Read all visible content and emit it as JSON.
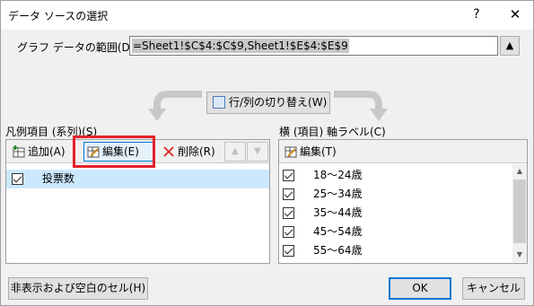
{
  "window": {
    "title": "データ ソースの選択",
    "help": "?",
    "close": "✕"
  },
  "range": {
    "label": "グラフ データの範囲(D):",
    "value": "=Sheet1!$C$4:$C$9,Sheet1!$E$4:$E$9"
  },
  "switch_button": {
    "label": "行/列の切り替え(W)"
  },
  "legend": {
    "header": "凡例項目 (系列)(S)",
    "add_label": "追加(A)",
    "edit_label": "編集(E)",
    "delete_label": "削除(R)",
    "items": [
      {
        "label": "投票数",
        "checked": true
      }
    ]
  },
  "axis": {
    "header": "横 (項目) 軸ラベル(C)",
    "edit_label": "編集(T)",
    "items": [
      {
        "label": "18～24歳",
        "checked": true
      },
      {
        "label": "25～34歳",
        "checked": true
      },
      {
        "label": "35～44歳",
        "checked": true
      },
      {
        "label": "45～54歳",
        "checked": true
      },
      {
        "label": "55～64歳",
        "checked": true
      }
    ]
  },
  "footer": {
    "hidden_cells_label": "非表示および空白のセル(H)",
    "ok_label": "OK",
    "cancel_label": "キャンセル"
  },
  "colors": {
    "highlight": "#e3212b",
    "accent": "#0078d7",
    "selection": "#cce8ff"
  }
}
